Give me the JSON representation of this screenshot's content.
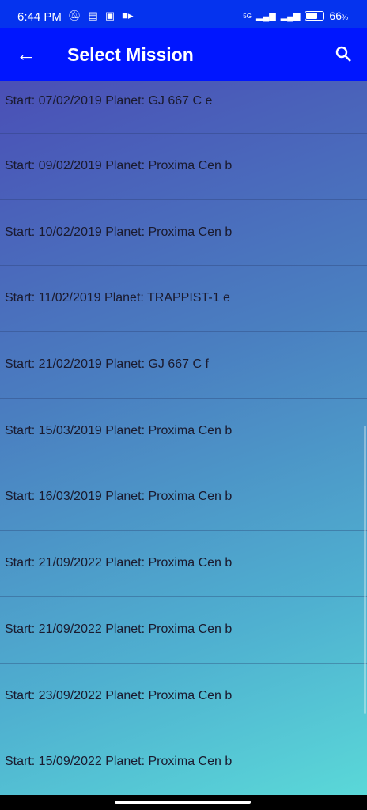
{
  "status_bar": {
    "time": "6:44 PM",
    "network": "5G",
    "battery": "66",
    "battery_unit": "%",
    "battery_level": 0.66
  },
  "app_bar": {
    "title": "Select Mission",
    "back_icon": "arrow-left-icon",
    "search_icon": "search-icon"
  },
  "missions": [
    {
      "label": "Start: 07/02/2019 Planet: GJ 667 C e"
    },
    {
      "label": "Start: 09/02/2019 Planet: Proxima Cen b"
    },
    {
      "label": "Start: 10/02/2019 Planet: Proxima Cen b"
    },
    {
      "label": "Start: 11/02/2019 Planet: TRAPPIST-1 e"
    },
    {
      "label": "Start: 21/02/2019 Planet: GJ 667 C f"
    },
    {
      "label": "Start: 15/03/2019 Planet: Proxima Cen b"
    },
    {
      "label": "Start: 16/03/2019 Planet: Proxima Cen b"
    },
    {
      "label": "Start: 21/09/2022 Planet: Proxima Cen b"
    },
    {
      "label": "Start: 21/09/2022 Planet: Proxima Cen b"
    },
    {
      "label": "Start: 23/09/2022 Planet: Proxima Cen b"
    },
    {
      "label": "Start: 15/09/2022 Planet: Proxima Cen b"
    }
  ]
}
